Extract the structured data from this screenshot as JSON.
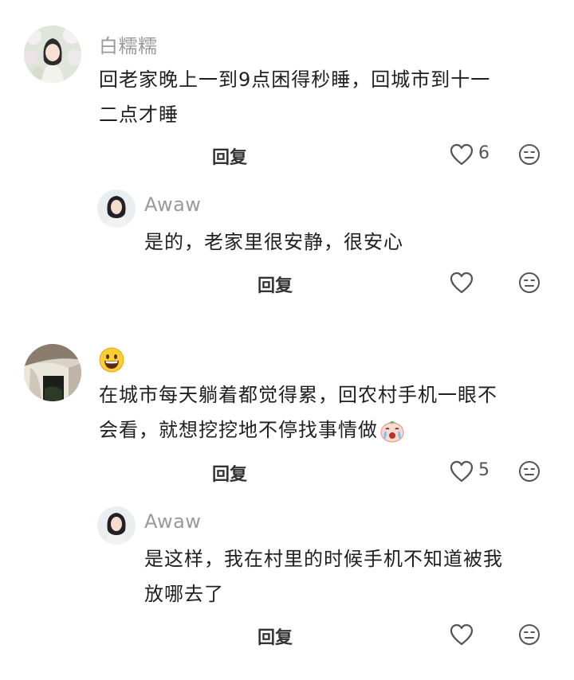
{
  "comments": [
    {
      "username": "白糯糯",
      "content_lines": [
        "回老家晚上一到9点困得秒睡，回城市到十一",
        "二点才睡"
      ],
      "reply_label": "回复",
      "likes": "6",
      "replies": [
        {
          "username": "Awaw",
          "content_lines": [
            "是的，老家里很安静，很安心"
          ],
          "reply_label": "回复"
        }
      ]
    },
    {
      "username": "",
      "username_icon": "grinning-face-emoji",
      "content_lines": [
        "在城市每天躺着都觉得累，回农村手机一眼不",
        "会看，就想挖挖地不停找事情做"
      ],
      "content_trailing_icon": "crying-face-emoji",
      "reply_label": "回复",
      "likes": "5",
      "replies": [
        {
          "username": "Awaw",
          "content_lines": [
            "是这样，我在村里的时候手机不知道被我",
            "放哪去了"
          ],
          "reply_label": "回复"
        }
      ]
    }
  ],
  "icons": {
    "like": "heart-outline-icon",
    "dislike": "neutral-face-icon"
  },
  "colors": {
    "text": "#1f1f1f",
    "username": "#9a9a9a",
    "icon": "#555555"
  }
}
